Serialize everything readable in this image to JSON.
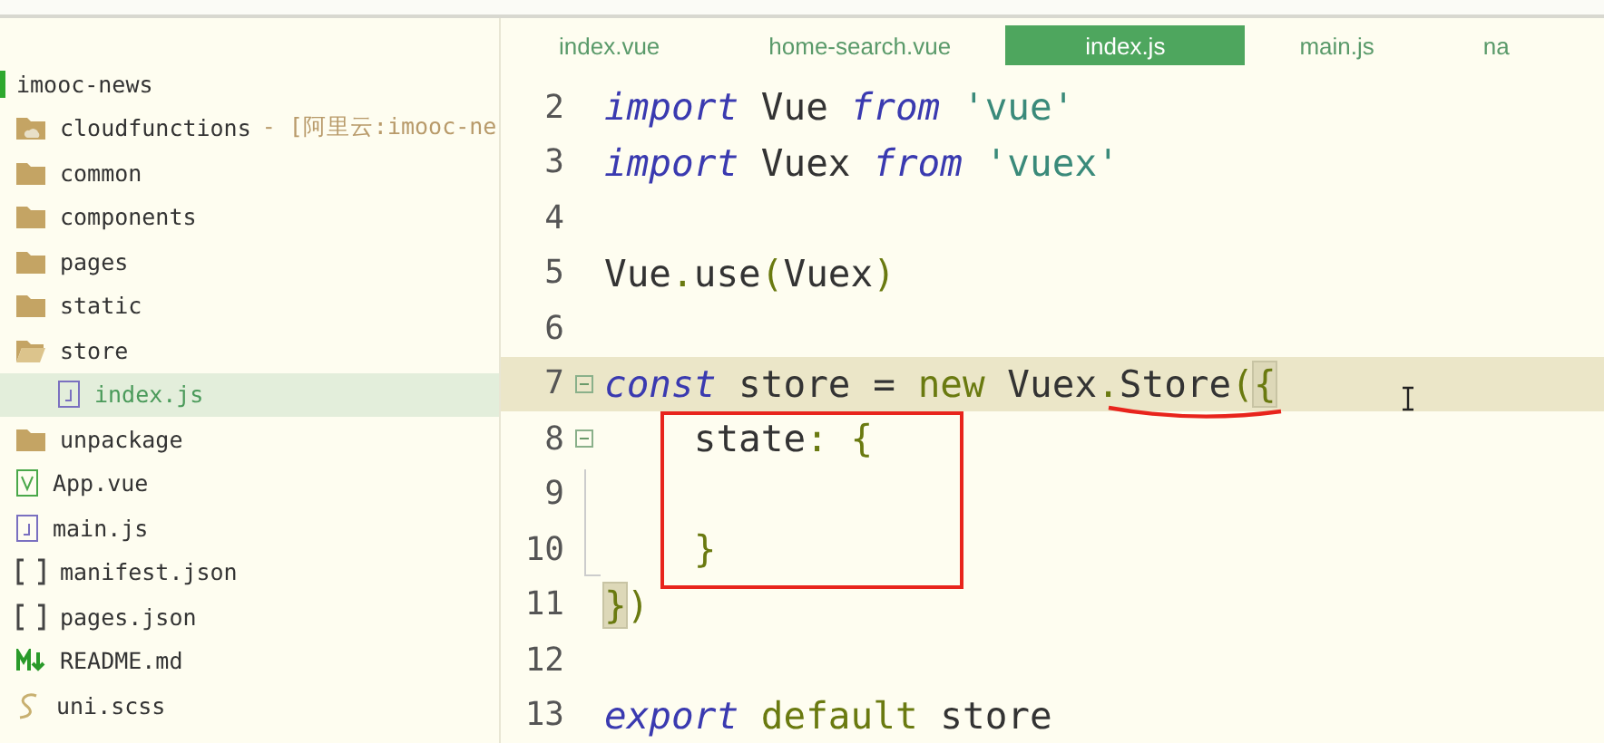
{
  "sidebar": {
    "root": "imooc-news",
    "items": [
      {
        "label": "cloudfunctions",
        "kind": "folder-cloud",
        "suffix": "- [阿里云:imooc-ne",
        "selected": false
      },
      {
        "label": "common",
        "kind": "folder",
        "selected": false
      },
      {
        "label": "components",
        "kind": "folder",
        "selected": false
      },
      {
        "label": "pages",
        "kind": "folder",
        "selected": false
      },
      {
        "label": "static",
        "kind": "folder",
        "selected": false
      },
      {
        "label": "store",
        "kind": "folder-open",
        "selected": false,
        "children": [
          {
            "label": "index.js",
            "kind": "file-js",
            "selected": true
          }
        ]
      },
      {
        "label": "unpackage",
        "kind": "folder",
        "selected": false
      },
      {
        "label": "App.vue",
        "kind": "file-vue",
        "selected": false
      },
      {
        "label": "main.js",
        "kind": "file-js",
        "selected": false
      },
      {
        "label": "manifest.json",
        "kind": "file-json",
        "selected": false
      },
      {
        "label": "pages.json",
        "kind": "file-json",
        "selected": false
      },
      {
        "label": "README.md",
        "kind": "file-md",
        "selected": false
      },
      {
        "label": "uni.scss",
        "kind": "file-scss",
        "selected": false
      }
    ]
  },
  "tabs": [
    {
      "label": "index.vue",
      "selected": false
    },
    {
      "label": "home-search.vue",
      "selected": false
    },
    {
      "label": "index.js",
      "selected": true
    },
    {
      "label": "main.js",
      "selected": false
    },
    {
      "label": "na",
      "selected": false
    }
  ],
  "editor": {
    "lines": [
      {
        "number": "2",
        "current": false,
        "fold": false,
        "tokens": [
          {
            "t": "import",
            "kind": "kw"
          },
          {
            "t": " Vue ",
            "kind": "id"
          },
          {
            "t": "from",
            "kind": "kw"
          },
          {
            "t": " 'vue'",
            "kind": "str"
          }
        ]
      },
      {
        "number": "3",
        "current": false,
        "fold": false,
        "tokens": [
          {
            "t": "import",
            "kind": "kw"
          },
          {
            "t": " Vuex ",
            "kind": "id"
          },
          {
            "t": "from",
            "kind": "kw"
          },
          {
            "t": " 'vuex'",
            "kind": "str"
          }
        ]
      },
      {
        "number": "4",
        "current": false,
        "fold": false
      },
      {
        "number": "5",
        "current": false,
        "fold": false,
        "tokens": [
          {
            "t": "Vue",
            "kind": "id"
          },
          {
            "t": ".",
            "kind": "punct"
          },
          {
            "t": "use",
            "kind": "id"
          },
          {
            "t": "(",
            "kind": "punct"
          },
          {
            "t": "Vuex",
            "kind": "id"
          },
          {
            "t": ")",
            "kind": "punct"
          }
        ]
      },
      {
        "number": "6",
        "current": false,
        "fold": false
      },
      {
        "number": "7",
        "current": true,
        "fold": true,
        "tokens": [
          {
            "t": "const",
            "kind": "kw"
          },
          {
            "t": " store = ",
            "kind": "id"
          },
          {
            "t": "new",
            "kind": "kw2"
          },
          {
            "t": " Vuex",
            "kind": "id"
          },
          {
            "t": ".",
            "kind": "punct"
          },
          {
            "t": "Store",
            "kind": "id"
          },
          {
            "t": "(",
            "kind": "punct"
          },
          {
            "t": "{",
            "kind": "match"
          }
        ]
      },
      {
        "number": "8",
        "current": false,
        "fold": true,
        "tokens": [
          {
            "t": "    state",
            "kind": "id"
          },
          {
            "t": ": {",
            "kind": "punct"
          }
        ]
      },
      {
        "number": "9",
        "current": false,
        "fold": false
      },
      {
        "number": "10",
        "current": false,
        "fold": false,
        "tokens": [
          {
            "t": "    }",
            "kind": "punct"
          }
        ]
      },
      {
        "number": "11",
        "current": false,
        "fold": false,
        "tokens": [
          {
            "t": "}",
            "kind": "match"
          },
          {
            "t": ")",
            "kind": "punct"
          }
        ]
      },
      {
        "number": "12",
        "current": false,
        "fold": false
      },
      {
        "number": "13",
        "current": false,
        "fold": false,
        "tokens": [
          {
            "t": "export",
            "kind": "kw"
          },
          {
            "t": " default",
            "kind": "kw2"
          },
          {
            "t": " store",
            "kind": "id"
          }
        ]
      }
    ]
  }
}
